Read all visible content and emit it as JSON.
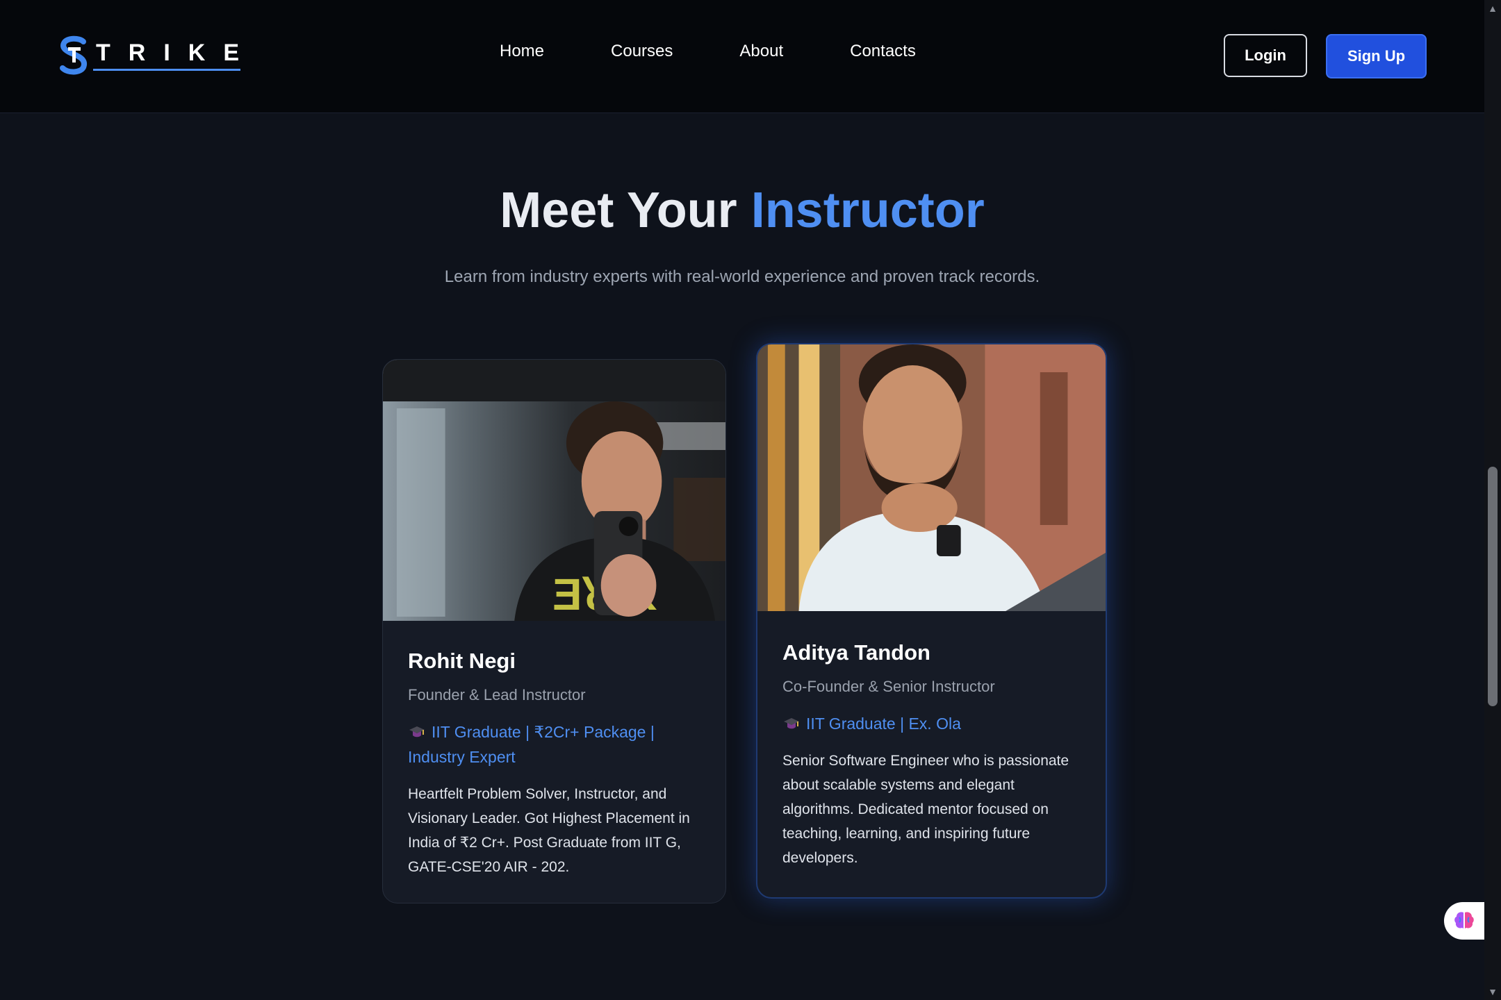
{
  "header": {
    "logo_text": "TRIKE",
    "nav": [
      "Home",
      "Courses",
      "About",
      "Contacts"
    ],
    "login_label": "Login",
    "signup_label": "Sign Up"
  },
  "section": {
    "title_main": "Meet Your ",
    "title_accent": "Instructor",
    "subtitle": "Learn from industry experts with real-world experience and proven track records."
  },
  "instructors": [
    {
      "name": "Rohit Negi",
      "role": "Founder & Lead Instructor",
      "credentials": "IIT Graduate | ₹2Cr+ Package | Industry Expert",
      "bio": "Heartfelt Problem Solver, Instructor, and Visionary Leader. Got Highest Placement in India of ₹2 Cr+. Post Graduate from IIT G, GATE-CSE'20 AIR - 202.",
      "photo_icon": "person-photo"
    },
    {
      "name": "Aditya Tandon",
      "role": "Co-Founder & Senior Instructor",
      "credentials": "IIT Graduate | Ex. Ola",
      "bio": "Senior Software Engineer who is passionate about scalable systems and elegant algorithms. Dedicated mentor focused on teaching, learning, and inspiring future developers.",
      "photo_icon": "person-photo"
    }
  ],
  "colors": {
    "accent": "#4f8ff2",
    "signup_bg": "#2150de",
    "background": "#0e121b",
    "header_bg": "#05070b"
  },
  "icons": {
    "graduation": "graduation-cap-icon",
    "assistant": "brain-icon"
  }
}
